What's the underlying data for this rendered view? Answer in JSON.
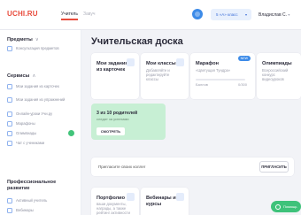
{
  "header": {
    "logo": "UCHI.RU",
    "tabs": [
      {
        "label": "Учитель"
      },
      {
        "label": "Завуч"
      }
    ],
    "class_select": "5 «А» класс",
    "user_name": "Владислав С."
  },
  "sidebar": {
    "subjects": {
      "title": "Предметы",
      "items": [
        {
          "label": "Консультация предметов"
        }
      ]
    },
    "services": {
      "title": "Сервисы",
      "items": [
        {
          "label": "Мои задания из карточек"
        },
        {
          "label": "Мои задания из упражнений"
        },
        {
          "label": "Онлайн-уроки Учи.ру"
        },
        {
          "label": "Марафоны"
        },
        {
          "label": "Олимпиады"
        },
        {
          "label": "Чат с учениками"
        }
      ]
    },
    "development": {
      "title": "Профессиональное развитие",
      "items": [
        {
          "label": "Активный учитель"
        },
        {
          "label": "Вебинары"
        }
      ]
    }
  },
  "main": {
    "title": "Учительская доска",
    "cards": [
      {
        "title": "Мои задания из карточек",
        "subtitle": ""
      },
      {
        "title": "Мои классы",
        "subtitle": "Добавляйте и редактируйте классы"
      },
      {
        "title": "Марафон",
        "subtitle": "«Цветущая Тундра»",
        "badge": "NEW",
        "progress_label": "Баллов",
        "progress_value": "0/300",
        "progress_fraction": 0.0
      },
      {
        "title": "Олимпиады",
        "subtitle": "Всероссийский конкурс видеоуроков"
      }
    ],
    "parents_card": {
      "title": "3 из 10 родителей",
      "subtitle": "следят за успехами",
      "button": "СМОТРЕТЬ"
    },
    "invite": {
      "text": "Пригласите своих коллег",
      "button": "ПРИГЛАСИТЬ"
    },
    "bottom_cards": [
      {
        "title": "Портфолио",
        "subtitle": "ваши документы, награды, а также рейтинг активности"
      },
      {
        "title": "Вебинары и курсы",
        "subtitle": ""
      }
    ]
  },
  "help": {
    "label": "Помощь"
  }
}
